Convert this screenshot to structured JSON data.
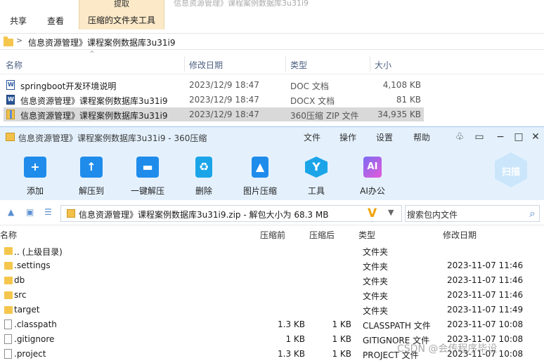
{
  "ribbon": {
    "tabs": [
      "共享",
      "查看"
    ],
    "extract_caption": "提取",
    "extract_tab": "压缩的文件夹工具",
    "path_hint": "信息资源管理》课程案例数据库3u31i9"
  },
  "explorer": {
    "address": "信息资源管理》课程案例数据库3u31i9",
    "columns": {
      "name": "名称",
      "modified": "修改日期",
      "type": "类型",
      "size": "大小"
    },
    "rows": [
      {
        "name": "springboot开发环境说明",
        "modified": "2023/12/9 18:47",
        "type": "DOC 文档",
        "size": "4,108 KB",
        "icon": "doc-icon"
      },
      {
        "name": "信息资源管理》课程案例数据库3u31i9",
        "modified": "2023/12/9 18:47",
        "type": "DOCX 文档",
        "size": "81 KB",
        "icon": "docx-icon"
      },
      {
        "name": "信息资源管理》课程案例数据库3u31i9",
        "modified": "2023/12/9 18:47",
        "type": "360压缩 ZIP 文件",
        "size": "34,935 KB",
        "icon": "zip-icon",
        "selected": true
      }
    ]
  },
  "zip": {
    "title": "信息资源管理》课程案例数据库3u31i9 - 360压缩",
    "menu": [
      "文件",
      "操作",
      "设置",
      "帮助"
    ],
    "toolbar": [
      {
        "label": "添加",
        "icon": "add-icon"
      },
      {
        "label": "解压到",
        "icon": "extract-to-icon"
      },
      {
        "label": "一键解压",
        "icon": "one-click-extract-icon"
      },
      {
        "label": "删除",
        "icon": "delete-icon"
      },
      {
        "label": "图片压缩",
        "icon": "image-compress-icon"
      },
      {
        "label": "工具",
        "icon": "tools-icon"
      },
      {
        "label": "AI办公",
        "icon": "ai-office-icon"
      }
    ],
    "scan_label": "扫描",
    "path": "信息资源管理》课程案例数据库3u31i9.zip - 解包大小为 68.3 MB",
    "search_placeholder": "搜索包内文件",
    "columns": {
      "name": "名称",
      "packed": "压缩前",
      "compressed": "压缩后",
      "type": "类型",
      "modified": "修改日期"
    },
    "rows": [
      {
        "name": ".. (上级目录)",
        "packed": "",
        "compressed": "",
        "type": "文件夹",
        "modified": "",
        "kind": "folder"
      },
      {
        "name": ".settings",
        "packed": "",
        "compressed": "",
        "type": "文件夹",
        "modified": "2023-11-07 11:46",
        "kind": "folder"
      },
      {
        "name": "db",
        "packed": "",
        "compressed": "",
        "type": "文件夹",
        "modified": "2023-11-07 11:46",
        "kind": "folder"
      },
      {
        "name": "src",
        "packed": "",
        "compressed": "",
        "type": "文件夹",
        "modified": "2023-11-07 11:46",
        "kind": "folder"
      },
      {
        "name": "target",
        "packed": "",
        "compressed": "",
        "type": "文件夹",
        "modified": "2023-11-07 11:49",
        "kind": "folder"
      },
      {
        "name": ".classpath",
        "packed": "1.3 KB",
        "compressed": "1 KB",
        "type": "CLASSPATH 文件",
        "modified": "2023-11-07 10:08",
        "kind": "file"
      },
      {
        "name": ".gitignore",
        "packed": "1 KB",
        "compressed": "1 KB",
        "type": "GITIGNORE 文件",
        "modified": "2023-11-07 10:08",
        "kind": "file"
      },
      {
        "name": ".project",
        "packed": "1.3 KB",
        "compressed": "1 KB",
        "type": "PROJECT 文件",
        "modified": "2023-11-07 10:08",
        "kind": "file"
      }
    ]
  },
  "watermark": "CSDN @会传程序毕设"
}
